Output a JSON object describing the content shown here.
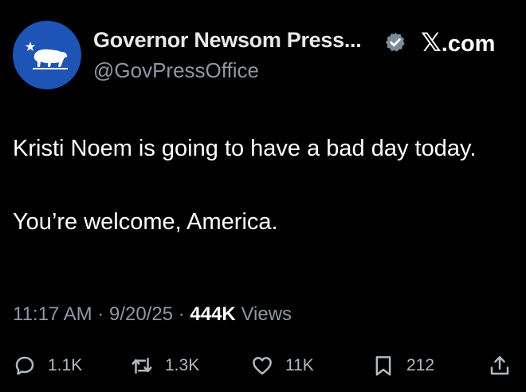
{
  "profile": {
    "display_name": "Governor Newsom Press...",
    "handle": "@GovPressOffice",
    "avatar_icon": "california-bear-logo",
    "avatar_color": "#1d54b5",
    "verified_icon": "verified-badge-icon"
  },
  "brand": {
    "x_mark": "𝕏",
    "suffix": ".com"
  },
  "tweet": {
    "line1": "Kristi Noem is going to have a bad day today.",
    "line2": "You’re welcome, America."
  },
  "meta": {
    "time": "11:17 AM",
    "date": "9/20/25",
    "separator": "·",
    "views_count": "444K",
    "views_label": "Views"
  },
  "actions": {
    "replies": "1.1K",
    "reposts": "1.3K",
    "likes": "11K",
    "bookmarks": "212"
  }
}
